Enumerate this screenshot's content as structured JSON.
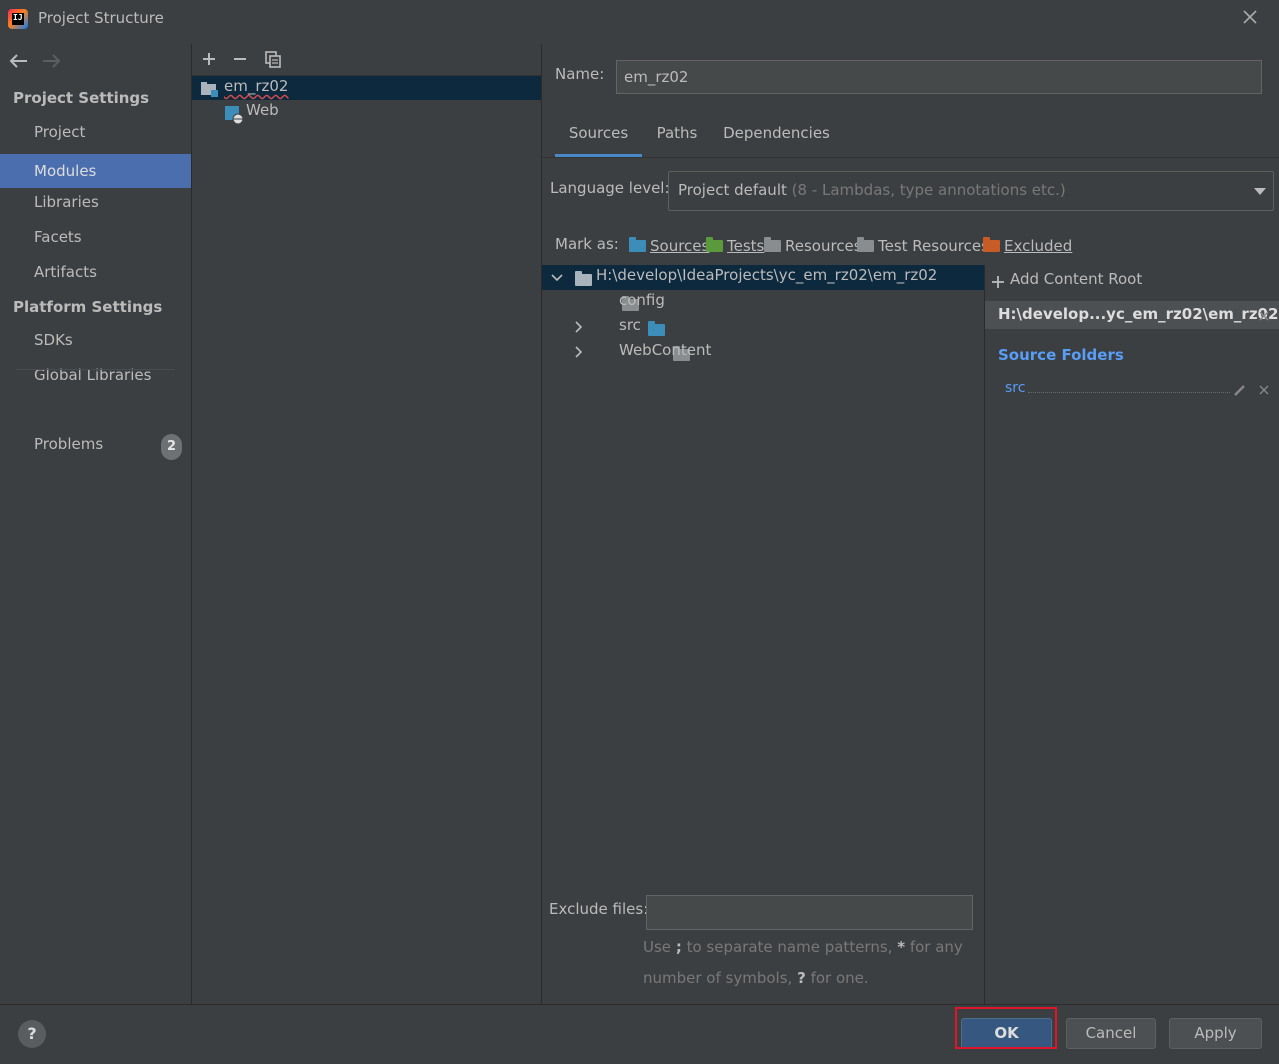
{
  "window": {
    "title": "Project Structure",
    "app_icon_text": "IJ"
  },
  "sidebar": {
    "project_settings_heading": "Project Settings",
    "project_items": [
      {
        "label": "Project"
      },
      {
        "label": "Modules",
        "selected": true
      },
      {
        "label": "Libraries"
      },
      {
        "label": "Facets"
      },
      {
        "label": "Artifacts"
      }
    ],
    "platform_settings_heading": "Platform Settings",
    "platform_items": [
      {
        "label": "SDKs"
      },
      {
        "label": "Global Libraries"
      }
    ],
    "problems": {
      "label": "Problems",
      "count": "2"
    }
  },
  "modules_tree": {
    "toolbar": {
      "add_icon": "plus-icon",
      "remove_icon": "minus-icon",
      "copy_icon": "copy-icon"
    },
    "module": "em_rz02",
    "facet": "Web"
  },
  "module_editor": {
    "name_label": "Name:",
    "name_value": "em_rz02",
    "tabs": [
      {
        "label": "Sources",
        "active": true
      },
      {
        "label": "Paths"
      },
      {
        "label": "Dependencies"
      }
    ],
    "language_level_label": "Language level:",
    "language_level_value": "Project default",
    "language_level_hint": "(8 - Lambdas, type annotations etc.)",
    "mark_as_label": "Mark as:",
    "mark_as": [
      {
        "label": "Sources",
        "color": "#3d8dba"
      },
      {
        "label": "Tests",
        "color": "#5a9a3c"
      },
      {
        "label": "Resources",
        "color": "#8a8d90"
      },
      {
        "label": "Test Resources",
        "color": "#8a8d90"
      },
      {
        "label": "Excluded",
        "color": "#c75c26"
      }
    ],
    "content_tree": {
      "root": "H:\\develop\\IdeaProjects\\yc_em_rz02\\em_rz02",
      "children": [
        {
          "label": "config",
          "expandable": false
        },
        {
          "label": "src",
          "expandable": true,
          "source": true
        },
        {
          "label": "WebContent",
          "expandable": true
        }
      ]
    },
    "content_root_panel": {
      "add_label": "Add Content Root",
      "root_header": "H:\\develop...yc_em_rz02\\em_rz02",
      "source_folders_title": "Source Folders",
      "source_folders": [
        "src"
      ]
    },
    "exclude_files_label": "Exclude files:",
    "exclude_files_value": "",
    "exclude_hint_line1_a": "Use",
    "exclude_hint_line1_sep": ";",
    "exclude_hint_line1_b": "to separate name patterns,",
    "exclude_hint_line1_star": "*",
    "exclude_hint_line1_c": "for any",
    "exclude_hint_line2_a": "number of symbols,",
    "exclude_hint_line2_q": "?",
    "exclude_hint_line2_b": "for one."
  },
  "footer": {
    "help_label": "?",
    "ok_label": "OK",
    "cancel_label": "Cancel",
    "apply_label": "Apply"
  }
}
